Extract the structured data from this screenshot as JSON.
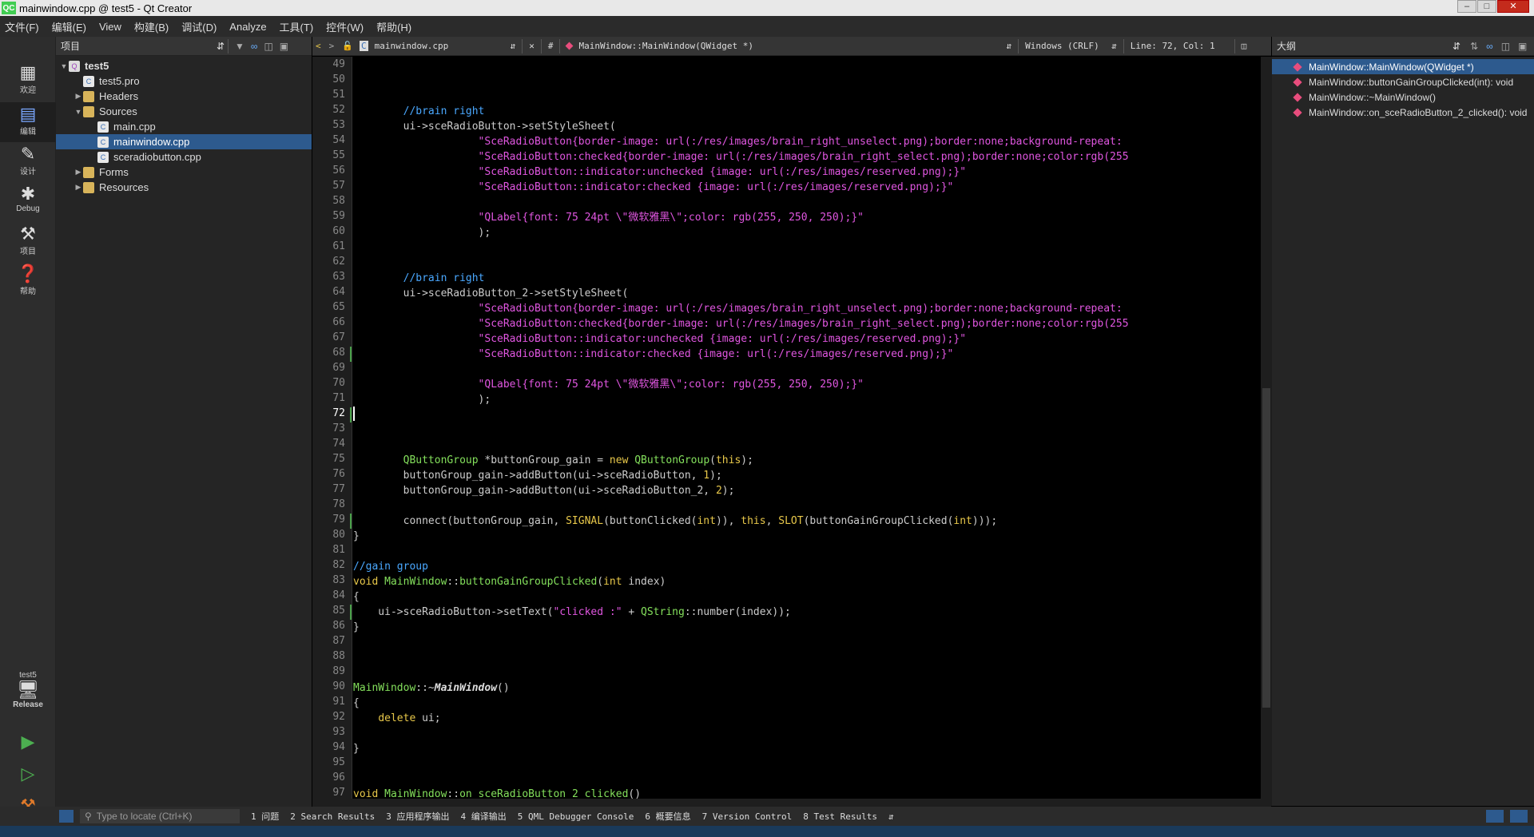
{
  "window": {
    "title": "mainwindow.cpp @ test5 - Qt Creator",
    "app_icon": "QC"
  },
  "menu": [
    "文件(F)",
    "编辑(E)",
    "View",
    "构建(B)",
    "调试(D)",
    "Analyze",
    "工具(T)",
    "控件(W)",
    "帮助(H)"
  ],
  "modes": {
    "welcome": "欢迎",
    "edit": "编辑",
    "design": "设计",
    "debug": "Debug",
    "projects": "项目",
    "help": "帮助",
    "kit_project": "test5",
    "kit_build": "Release"
  },
  "projects_panel": {
    "title": "项目"
  },
  "tree": [
    {
      "label": "test5",
      "level": 0,
      "kind": "proj",
      "expanded": true,
      "bold": true
    },
    {
      "label": "test5.pro",
      "level": 1,
      "kind": "file"
    },
    {
      "label": "Headers",
      "level": 1,
      "kind": "folder",
      "expanded": false
    },
    {
      "label": "Sources",
      "level": 1,
      "kind": "folder",
      "expanded": true
    },
    {
      "label": "main.cpp",
      "level": 2,
      "kind": "file"
    },
    {
      "label": "mainwindow.cpp",
      "level": 2,
      "kind": "file",
      "selected": true
    },
    {
      "label": "sceradiobutton.cpp",
      "level": 2,
      "kind": "file"
    },
    {
      "label": "Forms",
      "level": 1,
      "kind": "folder",
      "expanded": false
    },
    {
      "label": "Resources",
      "level": 1,
      "kind": "folder",
      "expanded": false
    }
  ],
  "editor": {
    "file": "mainwindow.cpp",
    "symbol": "MainWindow::MainWindow(QWidget *)",
    "hash": "#",
    "line_ending": "Windows (CRLF)",
    "position": "Line: 72, Col: 1",
    "current_line": 72,
    "first_line": 49,
    "changed_lines": [
      68,
      72,
      79,
      85
    ]
  },
  "code_lines": [
    [],
    [],
    [],
    [
      [
        "        ",
        ""
      ],
      [
        "//brain right",
        "cm"
      ]
    ],
    [
      [
        "        ui->sceRadioButton->setStyleSheet(",
        ""
      ]
    ],
    [
      [
        "                    ",
        ""
      ],
      [
        "\"SceRadioButton{border-image: url(:/res/images/brain_right_unselect.png);border:none;background-repeat:",
        "st"
      ]
    ],
    [
      [
        "                    ",
        ""
      ],
      [
        "\"SceRadioButton:checked{border-image: url(:/res/images/brain_right_select.png);border:none;color:rgb(255",
        "st"
      ]
    ],
    [
      [
        "                    ",
        ""
      ],
      [
        "\"SceRadioButton::indicator:unchecked {image: url(:/res/images/reserved.png);}\"",
        "st"
      ]
    ],
    [
      [
        "                    ",
        ""
      ],
      [
        "\"SceRadioButton::indicator:checked {image: url(:/res/images/reserved.png);}\"",
        "st"
      ]
    ],
    [],
    [
      [
        "                    ",
        ""
      ],
      [
        "\"QLabel{font: 75 24pt \\\"微软雅黑\\\";color: rgb(255, 250, 250);}\"",
        "st"
      ]
    ],
    [
      [
        "                    );",
        ""
      ]
    ],
    [],
    [],
    [
      [
        "        ",
        ""
      ],
      [
        "//brain right",
        "cm"
      ]
    ],
    [
      [
        "        ui->sceRadioButton_2->setStyleSheet(",
        ""
      ]
    ],
    [
      [
        "                    ",
        ""
      ],
      [
        "\"SceRadioButton{border-image: url(:/res/images/brain_right_unselect.png);border:none;background-repeat:",
        "st"
      ]
    ],
    [
      [
        "                    ",
        ""
      ],
      [
        "\"SceRadioButton:checked{border-image: url(:/res/images/brain_right_select.png);border:none;color:rgb(255",
        "st"
      ]
    ],
    [
      [
        "                    ",
        ""
      ],
      [
        "\"SceRadioButton::indicator:unchecked {image: url(:/res/images/reserved.png);}\"",
        "st"
      ]
    ],
    [
      [
        "                    ",
        ""
      ],
      [
        "\"SceRadioButton::indicator:checked {image: url(:/res/images/reserved.png);}\"",
        "st"
      ]
    ],
    [],
    [
      [
        "                    ",
        ""
      ],
      [
        "\"QLabel{font: 75 24pt \\\"微软雅黑\\\";color: rgb(255, 250, 250);}\"",
        "st"
      ]
    ],
    [
      [
        "                    );",
        ""
      ]
    ],
    [],
    [],
    [],
    [
      [
        "        ",
        ""
      ],
      [
        "QButtonGroup",
        "ty"
      ],
      [
        " *buttonGroup_gain = ",
        ""
      ],
      [
        "new",
        "kw"
      ],
      [
        " ",
        ""
      ],
      [
        "QButtonGroup",
        "ty"
      ],
      [
        "(",
        ""
      ],
      [
        "this",
        "kw"
      ],
      [
        ");",
        ""
      ]
    ],
    [
      [
        "        buttonGroup_gain->addButton(ui->sceRadioButton, ",
        ""
      ],
      [
        "1",
        "nm"
      ],
      [
        ");",
        ""
      ]
    ],
    [
      [
        "        buttonGroup_gain->addButton(ui->sceRadioButton_2, ",
        ""
      ],
      [
        "2",
        "nm"
      ],
      [
        ");",
        ""
      ]
    ],
    [],
    [
      [
        "        connect(buttonGroup_gain, ",
        ""
      ],
      [
        "SIGNAL",
        "kw"
      ],
      [
        "(buttonClicked(",
        ""
      ],
      [
        "int",
        "kw"
      ],
      [
        ")), ",
        ""
      ],
      [
        "this",
        "kw"
      ],
      [
        ", ",
        ""
      ],
      [
        "SLOT",
        "kw"
      ],
      [
        "(buttonGainGroupClicked(",
        ""
      ],
      [
        "int",
        "kw"
      ],
      [
        ")));",
        ""
      ]
    ],
    [
      [
        "}",
        ""
      ]
    ],
    [],
    [
      [
        "//gain group",
        "cm"
      ]
    ],
    [
      [
        "void",
        "kw"
      ],
      [
        " ",
        ""
      ],
      [
        "MainWindow",
        "ty"
      ],
      [
        "::",
        ""
      ],
      [
        "buttonGainGroupClicked",
        "fn"
      ],
      [
        "(",
        ""
      ],
      [
        "int",
        "kw"
      ],
      [
        " index)",
        ""
      ]
    ],
    [
      [
        "{",
        ""
      ]
    ],
    [
      [
        "    ui->sceRadioButton->setText(",
        ""
      ],
      [
        "\"clicked :\"",
        "st"
      ],
      [
        " + ",
        ""
      ],
      [
        "QString",
        "ty"
      ],
      [
        "::number(index));",
        ""
      ]
    ],
    [
      [
        "}",
        ""
      ]
    ],
    [],
    [],
    [],
    [
      [
        "MainWindow",
        "ty"
      ],
      [
        "::~",
        ""
      ],
      [
        "MainWindow",
        "it"
      ],
      [
        "()",
        ""
      ]
    ],
    [
      [
        "{",
        ""
      ]
    ],
    [
      [
        "    ",
        ""
      ],
      [
        "delete",
        "kw"
      ],
      [
        " ui;",
        ""
      ]
    ],
    [],
    [
      [
        "}",
        ""
      ]
    ],
    [],
    [],
    [
      [
        "void",
        "kw"
      ],
      [
        " ",
        ""
      ],
      [
        "MainWindow",
        "ty"
      ],
      [
        "::",
        ""
      ],
      [
        "on_sceRadioButton_2_clicked",
        "fn"
      ],
      [
        "()",
        ""
      ]
    ]
  ],
  "outline": {
    "title": "大纲",
    "items": [
      {
        "label": "MainWindow::MainWindow(QWidget *)",
        "selected": true
      },
      {
        "label": "MainWindow::buttonGainGroupClicked(int): void"
      },
      {
        "label": "MainWindow::~MainWindow()"
      },
      {
        "label": "MainWindow::on_sceRadioButton_2_clicked(): void"
      }
    ]
  },
  "statusbar": {
    "locator_placeholder": "Type to locate (Ctrl+K)",
    "panes": [
      "1 问题",
      "2 Search Results",
      "3 应用程序输出",
      "4 编译输出",
      "5 QML Debugger Console",
      "6 概要信息",
      "7 Version Control",
      "8 Test Results"
    ]
  },
  "colors": {
    "accent": "#2d5a8e",
    "keyword": "#e8c84a",
    "type": "#84e05c",
    "comment": "#4aa8ff",
    "string": "#e056e0"
  }
}
